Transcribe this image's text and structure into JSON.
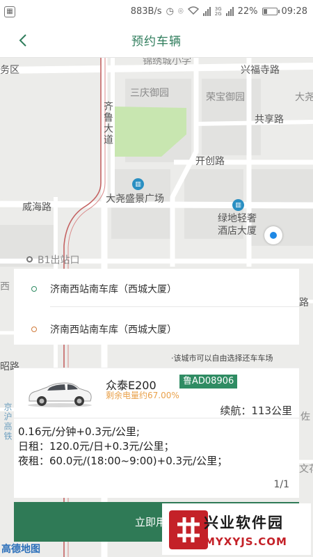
{
  "status_bar": {
    "speed": "883B/s",
    "network_top": "3G",
    "network_bottom": "2G",
    "battery": "22%",
    "time": "09:28",
    "icons": [
      "notification-icon",
      "clock-icon",
      "location-icon",
      "wifi-icon",
      "signal-icon",
      "battery-icon"
    ]
  },
  "nav": {
    "title": "预约车辆",
    "back_icon": "back-chevron-icon"
  },
  "map": {
    "labels": {
      "school": "锦绣城小学",
      "xingfu": "兴福寺路",
      "district": "务区",
      "sanqing": "三庆御园",
      "rongbao": "荣宝御园",
      "dayao_right": "大尧",
      "gongxiang": "共享路",
      "qilu": "齐鲁大道",
      "kaichuang": "开创路",
      "dayao_plaza": "大尧盛景广场",
      "weihai": "威海路",
      "lvdi": "绿地轻奢",
      "hotel": "酒店大厦",
      "b1": "B1出站口",
      "xi": "西",
      "lu": "路",
      "zhaolu": "昭路",
      "expressway": "京沪高铁",
      "zuo": "佐",
      "wen": "文花",
      "gaode": "高德地图"
    },
    "colors": {
      "background": "#ececea",
      "road": "#ffffff",
      "park": "#c8e6b0",
      "rail": "#c46262",
      "poi": "#2a8fc2"
    }
  },
  "route": {
    "start": "济南西站南车库（西城大厦）",
    "end": "济南西站南车库（西城大厦）",
    "start_color": "#2f8c63",
    "end_color": "#d07a3a"
  },
  "notice": "·该城市可以自由选择还车车场",
  "car": {
    "name": "众泰E200",
    "plate": "鲁AD08906",
    "battery": "剩余电量约67.00%",
    "range": "续航：113公里"
  },
  "pricing": {
    "per_minute": "0.16元/分钟+0.3元/公里;",
    "daily": "日租：120.0元/日+0.3元/公里；",
    "night": "夜租：60.0元/(18:00~9:00)+0.3元/公里；",
    "page": "1/1"
  },
  "action": {
    "label": "立即用车"
  },
  "watermark": {
    "title": "兴业软件园",
    "url": "MYXYJS.COM"
  }
}
